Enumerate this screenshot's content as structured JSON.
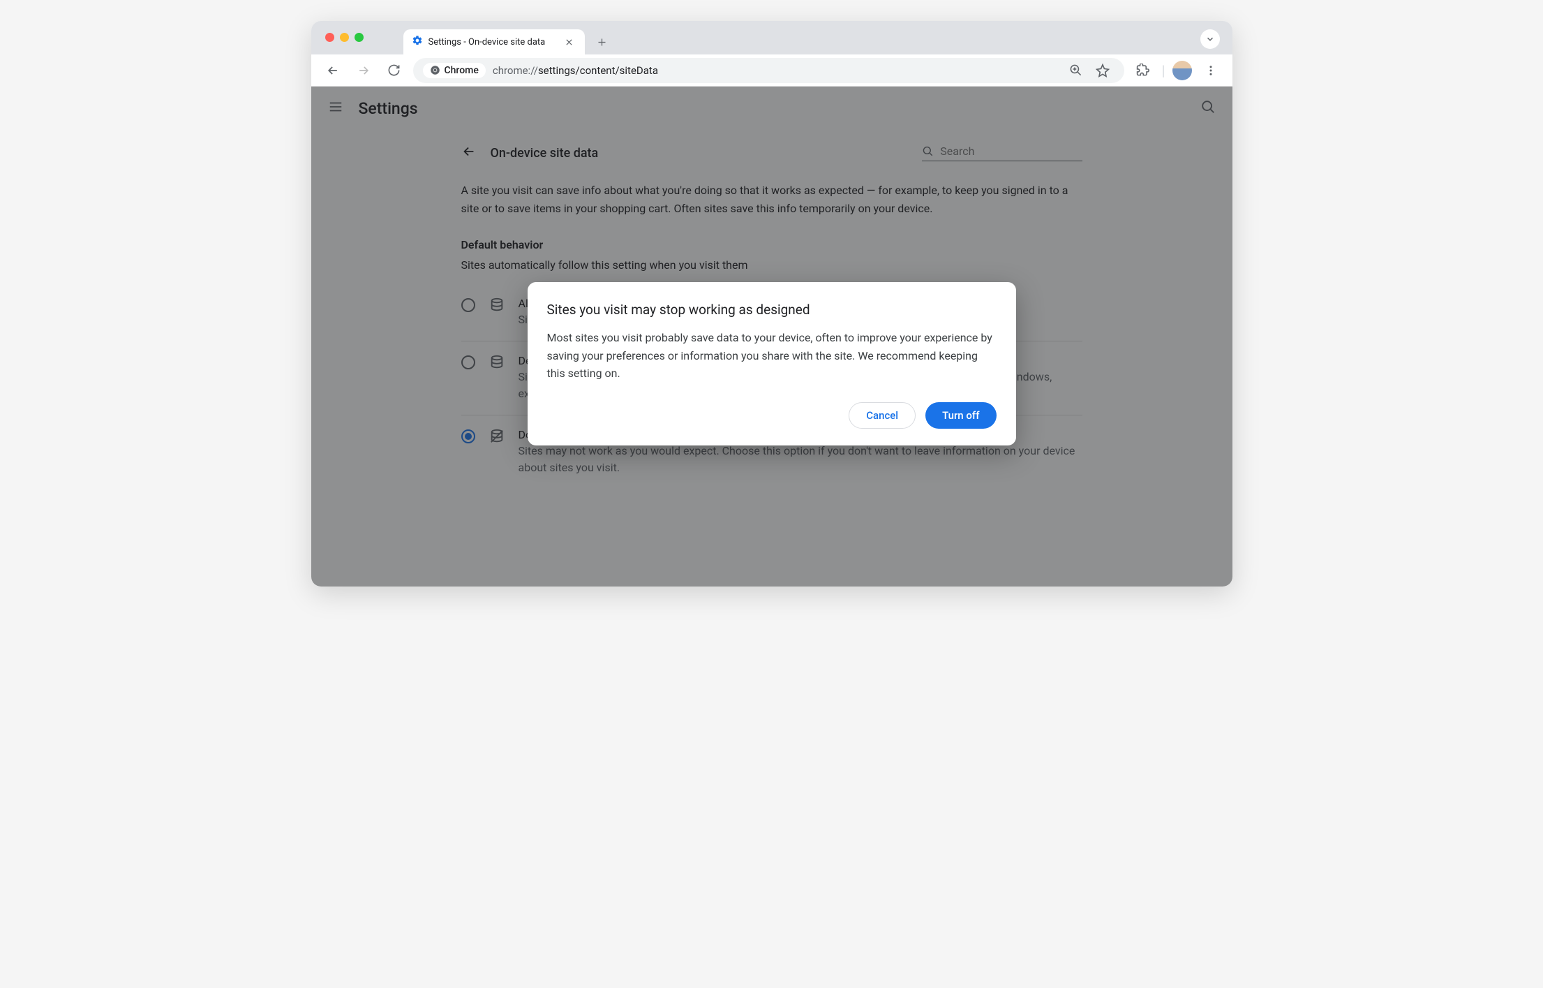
{
  "tab": {
    "title": "Settings - On-device site data"
  },
  "addr": {
    "chip": "Chrome",
    "scheme": "chrome://",
    "path": "settings/content/siteData"
  },
  "header": {
    "title": "Settings"
  },
  "panel": {
    "title": "On-device site data",
    "search_placeholder": "Search",
    "description": "A site you visit can save info about what you're doing so that it works as expected — for example, to keep you signed in to a site or to save items in your shopping cart. Often sites save this info temporarily on your device.",
    "default_behavior_label": "Default behavior",
    "default_behavior_sub": "Sites automatically follow this setting when you visit them"
  },
  "options": [
    {
      "title": "Allow sites to save data on your device (recommended)",
      "desc": "Sites will work as expected.",
      "selected": false,
      "crossed": false
    },
    {
      "title": "Delete data sites have saved to your device when you close all windows",
      "desc": "Sites will probably work as expected. You'll be signed out of most sites when you close all Chrome windows, except your Google Account if you're signed in to Chrome.",
      "selected": false,
      "crossed": false
    },
    {
      "title": "Don't allow sites to save data on your device (not recommended)",
      "desc": "Sites may not work as you would expect. Choose this option if you don't want to leave information on your device about sites you visit.",
      "selected": true,
      "crossed": true
    }
  ],
  "dialog": {
    "title": "Sites you visit may stop working as designed",
    "body": "Most sites you visit probably save data to your device, often to improve your experience by saving your preferences or information you share with the site. We recommend keeping this setting on.",
    "cancel": "Cancel",
    "confirm": "Turn off"
  }
}
